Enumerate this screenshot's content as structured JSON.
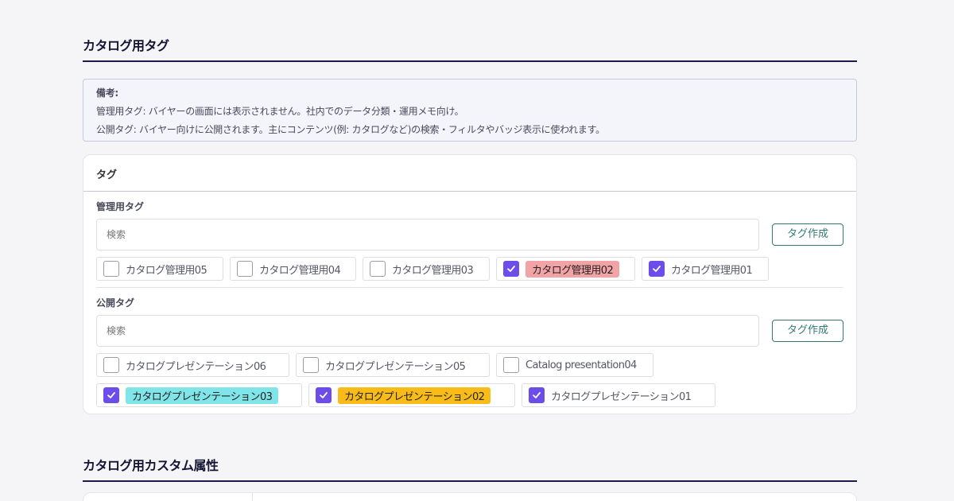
{
  "section1": {
    "title": "カタログ用タグ"
  },
  "note": {
    "title": "備考:",
    "line1": "管理用タグ: バイヤーの画面には表示されません。社内でのデータ分類・運用メモ向け。",
    "line2": "公開タグ: バイヤー向けに公開されます。主にコンテンツ(例: カタログなど)の検索・フィルタやバッジ表示に使われます。"
  },
  "card": {
    "header": "タグ",
    "management": {
      "label": "管理用タグ",
      "search_placeholder": "検索",
      "create_label": "タグ作成",
      "tags": [
        {
          "label": "カタログ管理用05",
          "checked": false,
          "highlight": ""
        },
        {
          "label": "カタログ管理用04",
          "checked": false,
          "highlight": ""
        },
        {
          "label": "カタログ管理用03",
          "checked": false,
          "highlight": ""
        },
        {
          "label": "カタログ管理用02",
          "checked": true,
          "highlight": "#f2a3a6"
        },
        {
          "label": "カタログ管理用01",
          "checked": true,
          "highlight": ""
        }
      ]
    },
    "public": {
      "label": "公開タグ",
      "search_placeholder": "検索",
      "create_label": "タグ作成",
      "tags": [
        {
          "label": "カタログプレゼンテーション06",
          "checked": false,
          "highlight": ""
        },
        {
          "label": "カタログプレゼンテーション05",
          "checked": false,
          "highlight": ""
        },
        {
          "label": "Catalog presentation04",
          "checked": false,
          "highlight": ""
        },
        {
          "label": "カタログプレゼンテーション03",
          "checked": true,
          "highlight": "#7fe5e8"
        },
        {
          "label": "カタログプレゼンテーション02",
          "checked": true,
          "highlight": "#f8bb17"
        },
        {
          "label": "カタログプレゼンテーション01",
          "checked": true,
          "highlight": ""
        }
      ]
    }
  },
  "section2": {
    "title": "カタログ用カスタム属性"
  },
  "colors": {
    "accent": "#6c4dea",
    "button": "#2f7a74",
    "heading_rule": "#1c1c4a"
  }
}
